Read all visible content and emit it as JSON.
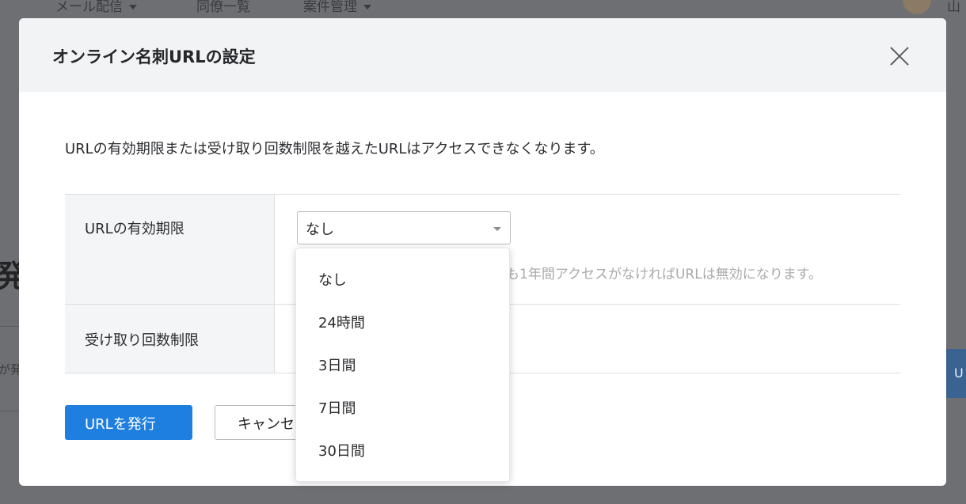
{
  "background": {
    "nav_items": [
      "メール配信",
      "同僚一覧",
      "案件管理"
    ],
    "user_name_fragment": "山",
    "heading_fragment": "発",
    "sub_fragment": "が発",
    "button_fragment": "U"
  },
  "modal": {
    "title": "オンライン名刺URLの設定",
    "description": "URLの有効期限または受け取り回数制限を越えたURLはアクセスできなくなります。",
    "rows": [
      {
        "label": "URLの有効期限"
      },
      {
        "label": "受け取り回数制限"
      }
    ],
    "expiry_select_value": "なし",
    "expiry_hint_fragment": "も1年間アクセスがなければURLは無効になります。",
    "primary_button": "URLを発行",
    "secondary_button": "キャンセル",
    "dropdown_options": [
      "なし",
      "24時間",
      "3日間",
      "7日間",
      "30日間"
    ]
  },
  "colors": {
    "primary": "#1f7fe0",
    "header_bg": "#f2f3f5",
    "label_bg": "#f4f5f7"
  },
  "icons": {
    "close": "close-icon",
    "caret": "chevron-down-icon"
  }
}
